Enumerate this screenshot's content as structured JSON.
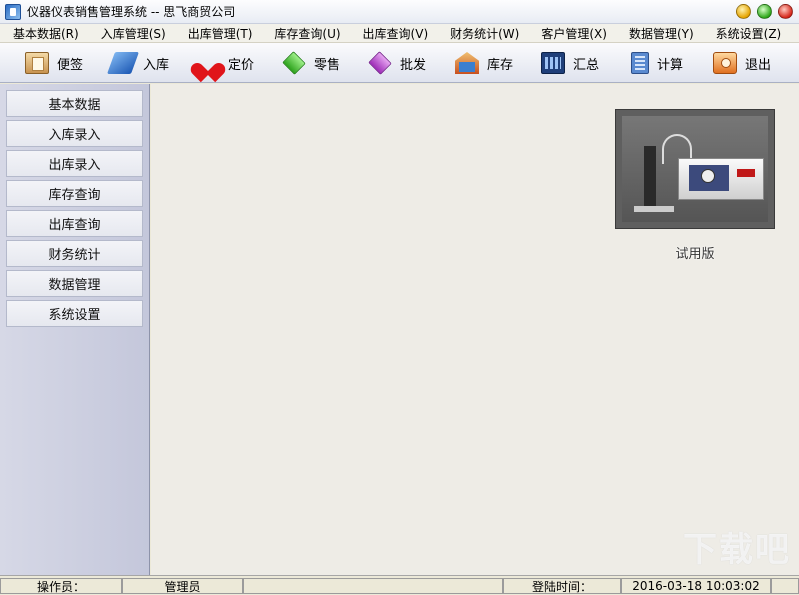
{
  "window": {
    "title": "仪器仪表销售管理系统 -- 思飞商贸公司"
  },
  "menu": [
    {
      "label": "基本数据(R)"
    },
    {
      "label": "入库管理(S)"
    },
    {
      "label": "出库管理(T)"
    },
    {
      "label": "库存查询(U)"
    },
    {
      "label": "出库查询(V)"
    },
    {
      "label": "财务统计(W)"
    },
    {
      "label": "客户管理(X)"
    },
    {
      "label": "数据管理(Y)"
    },
    {
      "label": "系统设置(Z)"
    }
  ],
  "toolbar": [
    {
      "label": "便签",
      "icon": "note-icon"
    },
    {
      "label": "入库",
      "icon": "stock-in-icon"
    },
    {
      "label": "定价",
      "icon": "price-heart-icon"
    },
    {
      "label": "零售",
      "icon": "retail-diamond-icon"
    },
    {
      "label": "批发",
      "icon": "wholesale-diamond-icon"
    },
    {
      "label": "库存",
      "icon": "warehouse-icon"
    },
    {
      "label": "汇总",
      "icon": "summary-icon"
    },
    {
      "label": "计算",
      "icon": "calculator-icon"
    },
    {
      "label": "退出",
      "icon": "exit-icon"
    }
  ],
  "sidebar": [
    {
      "label": "基本数据"
    },
    {
      "label": "入库录入"
    },
    {
      "label": "出库录入"
    },
    {
      "label": "库存查询"
    },
    {
      "label": "出库查询"
    },
    {
      "label": "财务统计"
    },
    {
      "label": "数据管理"
    },
    {
      "label": "系统设置"
    }
  ],
  "main": {
    "caption": "试用版"
  },
  "status": {
    "operator_label": "操作员：",
    "operator_value": "管理员",
    "login_label": "登陆时间：",
    "login_value": "2016-03-18 10:03:02"
  }
}
